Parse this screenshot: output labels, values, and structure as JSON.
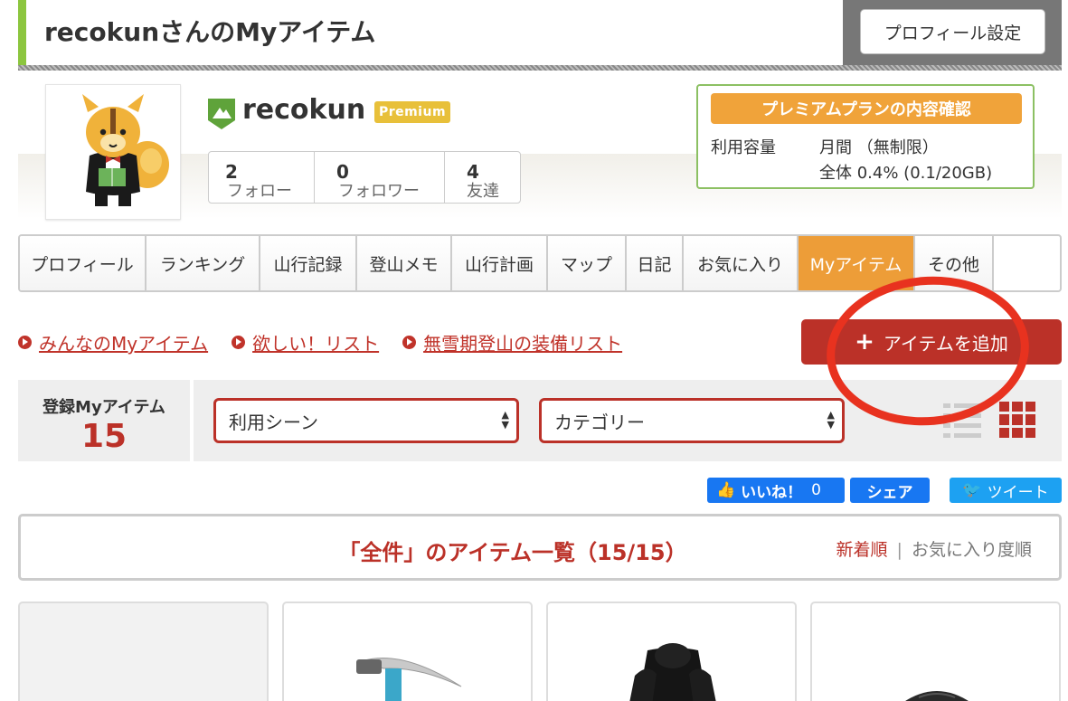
{
  "header": {
    "title": "recokunさんのMyアイテム",
    "profile_settings": "プロフィール設定"
  },
  "profile": {
    "username": "recokun",
    "premium_badge": "Premium",
    "stats": [
      {
        "num": "2",
        "label": "フォロー"
      },
      {
        "num": "0",
        "label": "フォロワー"
      },
      {
        "num": "4",
        "label": "友達"
      }
    ]
  },
  "plan": {
    "button": "プレミアムプランの内容確認",
    "capacity_label": "利用容量",
    "monthly": "月間 （無制限）",
    "total": "全体 0.4% (0.1/20GB)"
  },
  "tabs": [
    "プロフィール",
    "ランキング",
    "山行記録",
    "登山メモ",
    "山行計画",
    "マップ",
    "日記",
    "お気に入り",
    "Myアイテム",
    "その他"
  ],
  "links": [
    "みんなのMyアイテム",
    "欲しい！リスト",
    "無雪期登山の装備リスト"
  ],
  "add_button": "アイテムを追加",
  "filter": {
    "label": "登録Myアイテム",
    "count": "15",
    "scene_select": "利用シーン",
    "category_select": "カテゴリー"
  },
  "share": {
    "like": "いいね！",
    "like_count": "0",
    "share": "シェア",
    "tweet": "ツイート"
  },
  "list": {
    "title": "「全件」のアイテム一覧（15/15）",
    "sort_new": "新着順",
    "sort_sep": "|",
    "sort_fav": "お気に入り度順"
  },
  "colors": {
    "accent_red": "#bb3128",
    "tab_active": "#ed9d38",
    "green": "#8cc63f",
    "annotation": "#e8321f"
  }
}
